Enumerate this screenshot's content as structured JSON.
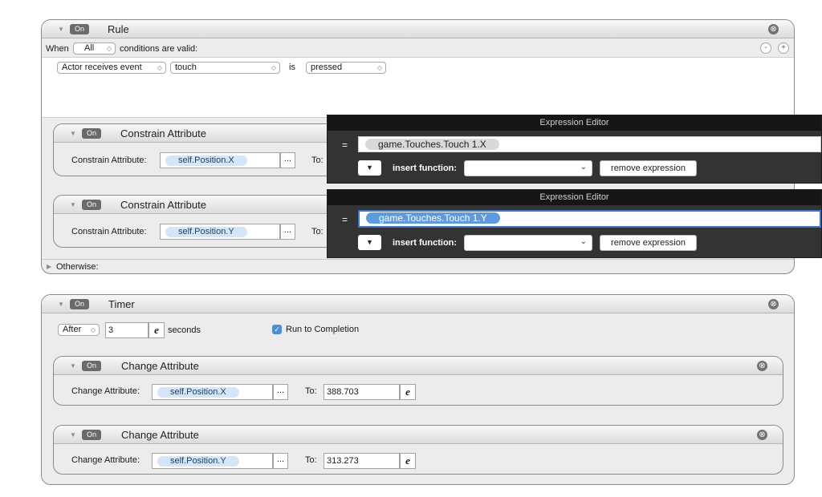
{
  "on_label": "On",
  "rule": {
    "title": "Rule",
    "when_label": "When",
    "condition_mode": "All",
    "conditions_suffix": "conditions are valid:",
    "condition": {
      "type": "Actor receives event",
      "event": "touch",
      "is_label": "is",
      "state": "pressed"
    },
    "otherwise_label": "Otherwise:",
    "minus_symbol": "-",
    "plus_symbol": "+",
    "constrain_x": {
      "title": "Constrain Attribute",
      "label": "Constrain Attribute:",
      "attribute": "self.Position.X",
      "to_label": "To:"
    },
    "constrain_y": {
      "title": "Constrain Attribute",
      "label": "Constrain Attribute:",
      "attribute": "self.Position.Y",
      "to_label": "To:"
    }
  },
  "expression_editor_x": {
    "title": "Expression Editor",
    "equals": "=",
    "expression": "game.Touches.Touch 1.X",
    "insert_label": "insert function:",
    "remove_label": "remove expression"
  },
  "expression_editor_y": {
    "title": "Expression Editor",
    "equals": "=",
    "expression": "game.Touches.Touch 1.Y",
    "insert_label": "insert function:",
    "remove_label": "remove expression"
  },
  "timer": {
    "title": "Timer",
    "mode": "After",
    "value": "3",
    "seconds_label": "seconds",
    "run_to_completion_label": "Run to Completion",
    "run_to_completion_checked": true,
    "change_x": {
      "title": "Change Attribute",
      "label": "Change Attribute:",
      "attribute": "self.Position.X",
      "to_label": "To:",
      "to_value": "388.703"
    },
    "change_y": {
      "title": "Change Attribute",
      "label": "Change Attribute:",
      "attribute": "self.Position.Y",
      "to_label": "To:",
      "to_value": "313.273"
    }
  },
  "icons": {
    "close": "⊗",
    "disclosure_down": "▼",
    "disclosure_right": "▶",
    "stepper": "◇",
    "dropdown_chevron": "⌄",
    "expression_e": "e",
    "ellipsis": "...",
    "check": "✓"
  },
  "colors": {
    "expression_bg": "#333333",
    "expression_header": "#161616",
    "pill": "#d4e6f8",
    "highlight": "#5c9be0",
    "check": "#4a90d9"
  }
}
